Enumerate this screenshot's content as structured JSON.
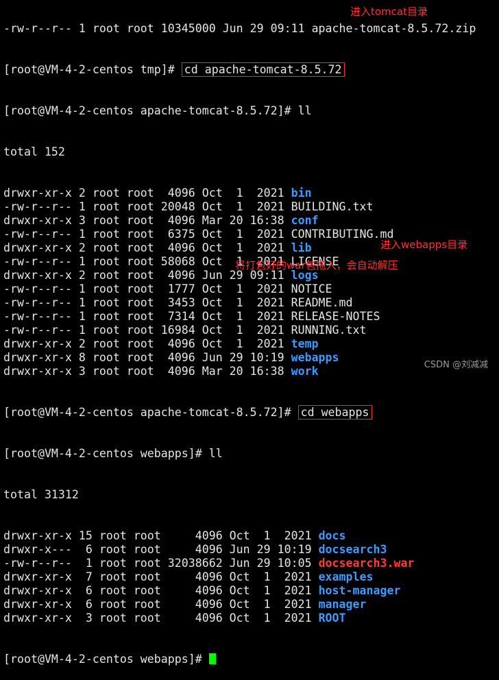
{
  "terminal": {
    "line0": "-rw-r--r-- 1 root root 10345000 Jun 29 09:11 apache-tomcat-8.5.72.zip",
    "prompt_tmp": "[root@VM-4-2-centos tmp]# ",
    "cmd_cd_tomcat": "cd apache-tomcat-8.5.72",
    "prompt_tomcat": "[root@VM-4-2-centos apache-tomcat-8.5.72]# ",
    "cmd_ll": "ll",
    "total1": "total 152",
    "list1": [
      {
        "meta": "drwxr-xr-x 2 root root  4096 Oct  1  2021 ",
        "name": "bin",
        "type": "dir"
      },
      {
        "meta": "-rw-r--r-- 1 root root 20048 Oct  1  2021 ",
        "name": "BUILDING.txt",
        "type": "file"
      },
      {
        "meta": "drwxr-xr-x 3 root root  4096 Mar 20 16:38 ",
        "name": "conf",
        "type": "dir"
      },
      {
        "meta": "-rw-r--r-- 1 root root  6375 Oct  1  2021 ",
        "name": "CONTRIBUTING.md",
        "type": "file"
      },
      {
        "meta": "drwxr-xr-x 2 root root  4096 Oct  1  2021 ",
        "name": "lib",
        "type": "dir"
      },
      {
        "meta": "-rw-r--r-- 1 root root 58068 Oct  1  2021 ",
        "name": "LICENSE",
        "type": "file"
      },
      {
        "meta": "drwxr-xr-x 2 root root  4096 Jun 29 09:11 ",
        "name": "logs",
        "type": "dir"
      },
      {
        "meta": "-rw-r--r-- 1 root root  1777 Oct  1  2021 ",
        "name": "NOTICE",
        "type": "file"
      },
      {
        "meta": "-rw-r--r-- 1 root root  3453 Oct  1  2021 ",
        "name": "README.md",
        "type": "file"
      },
      {
        "meta": "-rw-r--r-- 1 root root  7314 Oct  1  2021 ",
        "name": "RELEASE-NOTES",
        "type": "file"
      },
      {
        "meta": "-rw-r--r-- 1 root root 16984 Oct  1  2021 ",
        "name": "RUNNING.txt",
        "type": "file"
      },
      {
        "meta": "drwxr-xr-x 2 root root  4096 Oct  1  2021 ",
        "name": "temp",
        "type": "dir"
      },
      {
        "meta": "drwxr-xr-x 8 root root  4096 Jun 29 10:19 ",
        "name": "webapps",
        "type": "dir"
      },
      {
        "meta": "drwxr-xr-x 3 root root  4096 Mar 20 16:38 ",
        "name": "work",
        "type": "dir"
      }
    ],
    "cmd_cd_webapps": "cd webapps",
    "prompt_webapps": "[root@VM-4-2-centos webapps]# ",
    "total2": "total 31312",
    "list2": [
      {
        "meta": "drwxr-xr-x 15 root root     4096 Oct  1  2021 ",
        "name": "docs",
        "type": "dir"
      },
      {
        "meta": "drwxr-x---  6 root root     4096 Jun 29 10:19 ",
        "name": "docsearch3",
        "type": "dir"
      },
      {
        "meta": "-rw-r--r--  1 root root 32038662 Jun 29 10:05 ",
        "name": "docsearch3.war",
        "type": "archive"
      },
      {
        "meta": "drwxr-xr-x  7 root root     4096 Oct  1  2021 ",
        "name": "examples",
        "type": "dir"
      },
      {
        "meta": "drwxr-xr-x  6 root root     4096 Oct  1  2021 ",
        "name": "host-manager",
        "type": "dir"
      },
      {
        "meta": "drwxr-xr-x  6 root root     4096 Oct  1  2021 ",
        "name": "manager",
        "type": "dir"
      },
      {
        "meta": "drwxr-xr-x  3 root root     4096 Oct  1  2021 ",
        "name": "ROOT",
        "type": "dir"
      }
    ],
    "last_prompt": "[root@VM-4-2-centos webapps]# "
  },
  "annotations": {
    "enter_tomcat": "进入tomcat目录",
    "enter_webapps": "进入webapps目录",
    "drag_war": "将打包好的war包拖入，会自动解压"
  },
  "watermark": "CSDN @刘减减",
  "colors": {
    "background": "#000000",
    "text": "#e6e6e6",
    "directory": "#3d9bff",
    "archive": "#ff3a3a",
    "annotation": "#ff3030",
    "cursor": "#00ff00"
  }
}
